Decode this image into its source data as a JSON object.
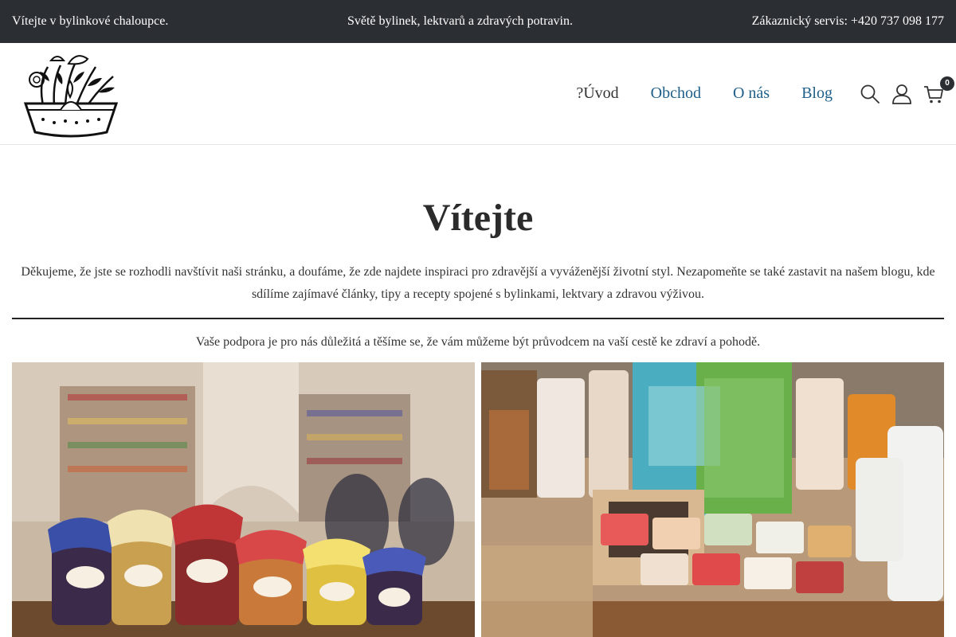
{
  "topbar": {
    "left": "Vítejte v bylinkové chaloupce.",
    "center": "Světě bylinek, lektvarů a zdravých potravin.",
    "right": "Zákaznický servis: +420 737 098 177"
  },
  "nav": {
    "items": [
      "?Úvod",
      "Obchod",
      "O nás",
      "Blog"
    ]
  },
  "header": {
    "cart_count": "0",
    "icons": [
      "search-icon",
      "user-icon",
      "cart-icon"
    ]
  },
  "main": {
    "title": "Vítejte",
    "intro": "Děkujeme, že jste se rozhodli navštívit naši stránku, a doufáme, že zde najdete inspiraci pro zdravější a vyváženější životní styl. Nezapomeňte se také zastavit na našem blogu, kde sdílíme zajímavé články, tipy a recepty spojené s bylinkami, lektvary a zdravou výživou.",
    "support": "Vaše podpora je pro nás důležitá a těšíme se, že vám můžeme být průvodcem na vaší cestě ke zdraví a pohodě."
  },
  "colors": {
    "topbar_bg": "#2b2f33",
    "nav_link": "#1e5f8a",
    "nav_active": "#333333"
  }
}
